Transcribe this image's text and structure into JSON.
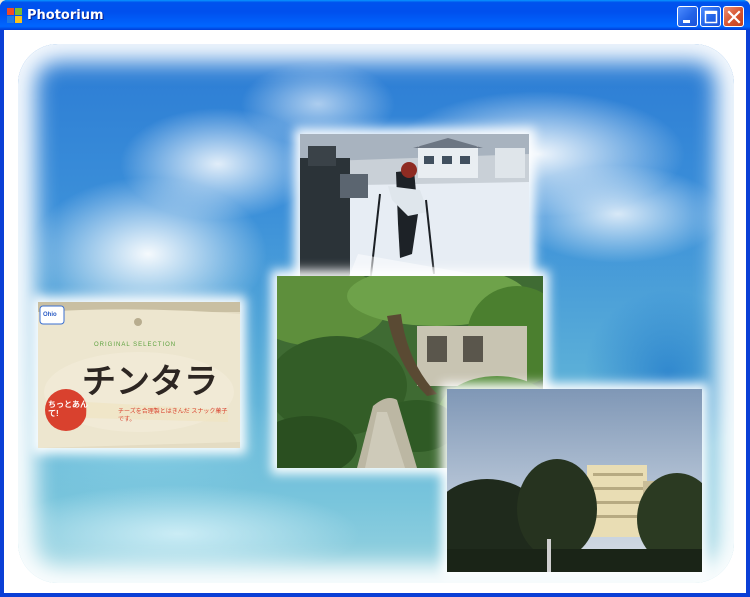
{
  "window": {
    "title": "Photorium",
    "icon": "photorium-app-icon",
    "controls": [
      "minimize-icon",
      "maximize-icon",
      "close-icon"
    ]
  },
  "photos": [
    {
      "name": "ski-slope-photo",
      "subject": "skiers on a snowy slope"
    },
    {
      "name": "snack-package-photo",
      "subject": "snack package",
      "brand": "Ohio",
      "line": "ORIGINAL SELECTION",
      "product": "チンタラ",
      "badge": "ちっとあんて!",
      "note": "チーズを合理製とはきんだ スナック菓子です。"
    },
    {
      "name": "garden-path-photo",
      "subject": "stone path through a garden"
    },
    {
      "name": "building-trees-photo",
      "subject": "building behind trees at dusk"
    }
  ],
  "colors": {
    "titlebar": "#0053ee",
    "frame": "#0a3fd6",
    "close": "#d6532e"
  }
}
